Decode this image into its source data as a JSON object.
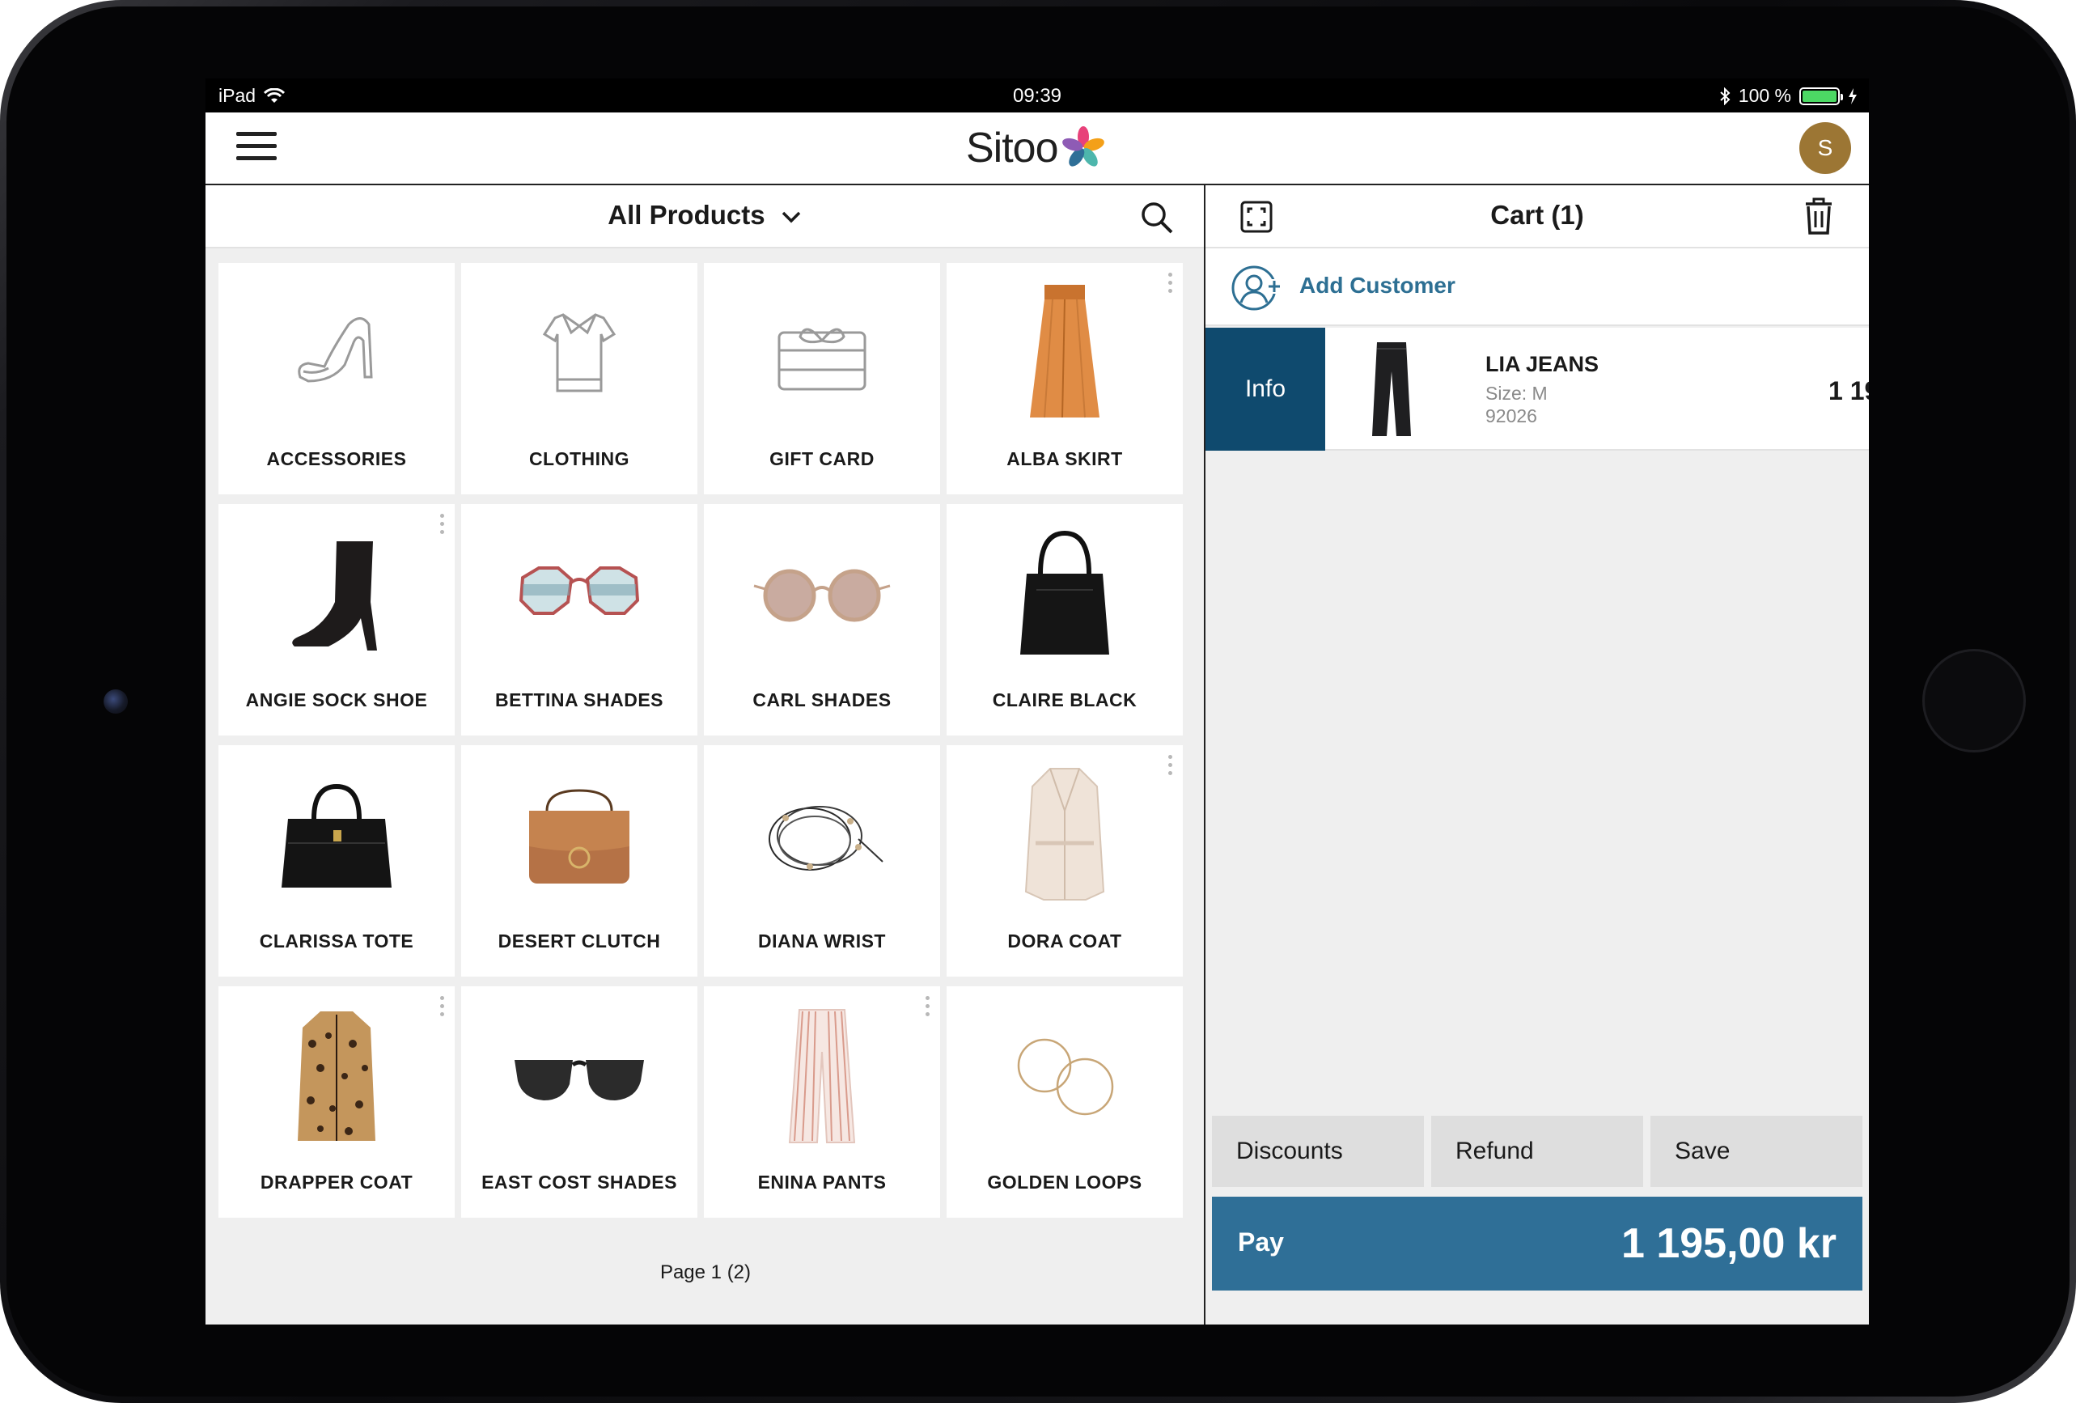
{
  "status": {
    "device": "iPad",
    "time": "09:39",
    "battery": "100 %"
  },
  "header": {
    "brand": "Sitoo",
    "user_initial": "S"
  },
  "catalog": {
    "title": "All Products",
    "tiles": [
      {
        "label": "ACCESSORIES",
        "icon": "shoe-outline-icon"
      },
      {
        "label": "CLOTHING",
        "icon": "shirt-outline-icon"
      },
      {
        "label": "GIFT CARD",
        "icon": "gift-card-icon"
      },
      {
        "label": "ALBA SKIRT",
        "icon": "skirt-icon"
      },
      {
        "label": "ANGIE SOCK SHOE",
        "icon": "boot-icon"
      },
      {
        "label": "BETTINA SHADES",
        "icon": "sunglasses-icon"
      },
      {
        "label": "CARL SHADES",
        "icon": "sunglasses-icon"
      },
      {
        "label": "CLAIRE BLACK",
        "icon": "handbag-icon"
      },
      {
        "label": "CLARISSA TOTE",
        "icon": "tote-icon"
      },
      {
        "label": "DESERT CLUTCH",
        "icon": "clutch-icon"
      },
      {
        "label": "DIANA WRIST",
        "icon": "bracelet-icon"
      },
      {
        "label": "DORA COAT",
        "icon": "coat-icon"
      },
      {
        "label": "DRAPPER COAT",
        "icon": "leopard-coat-icon"
      },
      {
        "label": "EAST COST SHADES",
        "icon": "sunglasses-icon"
      },
      {
        "label": "ENINA PANTS",
        "icon": "pants-icon"
      },
      {
        "label": "GOLDEN LOOPS",
        "icon": "earrings-icon"
      }
    ],
    "pager": "Page 1 (2)"
  },
  "cart": {
    "title": "Cart (1)",
    "add_customer": "Add Customer",
    "line": {
      "info": "Info",
      "name": "LIA JEANS",
      "size": "Size: M",
      "sku": "92026",
      "price": "1 19"
    },
    "actions": {
      "discounts": "Discounts",
      "refund": "Refund",
      "save": "Save"
    },
    "pay": {
      "label": "Pay",
      "total": "1 195,00 kr"
    }
  },
  "colors": {
    "accent": "#2f6f97",
    "info": "#0f4a6e",
    "avatar": "#9c7634"
  }
}
